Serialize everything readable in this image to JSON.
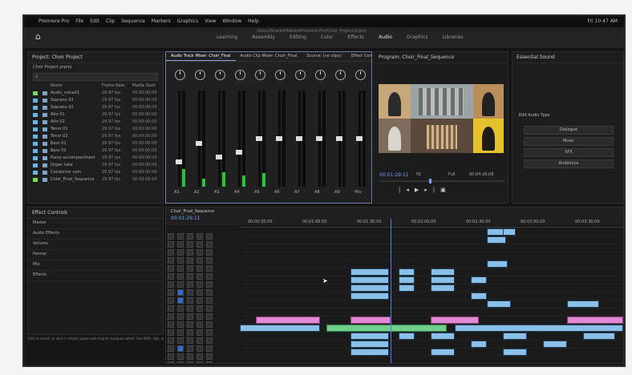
{
  "menubar": {
    "apple": "",
    "items": [
      "Premiere Pro",
      "File",
      "Edit",
      "Clip",
      "Sequence",
      "Markers",
      "Graphics",
      "View",
      "Window",
      "Help"
    ],
    "status": "Fri 10:47 AM"
  },
  "app": {
    "title": "/Users/Shared/Adobe/Premiere Pro/Choir_Project.prproj",
    "workspaces": [
      "Learning",
      "Assembly",
      "Editing",
      "Color",
      "Effects",
      "Audio",
      "Graphics",
      "Libraries"
    ],
    "active_workspace": "Audio"
  },
  "project_panel": {
    "title": "Project: Choir Project",
    "bin": "Choir Project.prproj",
    "search_placeholder": "",
    "columns": [
      "Name",
      "Frame Rate",
      "Media Start"
    ],
    "rows": [
      {
        "name": "Audio_voice01",
        "swatch": "#7ed957",
        "rate": "29.97 fps",
        "start": "00:00:00:00"
      },
      {
        "name": "Soprano 01",
        "swatch": "#67b7e3",
        "rate": "29.97 fps",
        "start": "00:00:00:00"
      },
      {
        "name": "Soprano 02",
        "swatch": "#67b7e3",
        "rate": "29.97 fps",
        "start": "00:00:00:00"
      },
      {
        "name": "Alto 01",
        "swatch": "#67b7e3",
        "rate": "29.97 fps",
        "start": "00:00:00:00"
      },
      {
        "name": "Alto 02",
        "swatch": "#67b7e3",
        "rate": "29.97 fps",
        "start": "00:00:00:00"
      },
      {
        "name": "Tenor 01",
        "swatch": "#67b7e3",
        "rate": "29.97 fps",
        "start": "00:00:00:00"
      },
      {
        "name": "Tenor 02",
        "swatch": "#67b7e3",
        "rate": "29.97 fps",
        "start": "00:00:00:00"
      },
      {
        "name": "Bass 01",
        "swatch": "#67b7e3",
        "rate": "29.97 fps",
        "start": "00:00:00:00"
      },
      {
        "name": "Bass 02",
        "swatch": "#67b7e3",
        "rate": "29.97 fps",
        "start": "00:00:00:00"
      },
      {
        "name": "Piano accompaniment",
        "swatch": "#67b7e3",
        "rate": "29.97 fps",
        "start": "00:00:00:00"
      },
      {
        "name": "Organ take",
        "swatch": "#67b7e3",
        "rate": "29.97 fps",
        "start": "00:00:00:00"
      },
      {
        "name": "Conductor cam",
        "swatch": "#67b7e3",
        "rate": "29.97 fps",
        "start": "00:00:00:00"
      },
      {
        "name": "Choir_Final_Sequence",
        "swatch": "#7ed957",
        "rate": "29.97 fps",
        "start": "00:00:00:00"
      }
    ]
  },
  "lower_left": {
    "title": "Effect Controls",
    "rows": [
      "Master",
      "Audio Effects",
      "Volume",
      "Panner",
      "Mix",
      "Effects"
    ]
  },
  "mixer": {
    "tabs": [
      "Audio Track Mixer: Choir_Final",
      "Audio Clip Mixer: Choir_Final",
      "Source: (no clips)",
      "Effect Controls"
    ],
    "active_tab": 0,
    "strips": [
      {
        "label": "A1",
        "level": 0.18,
        "fader": 0.25
      },
      {
        "label": "A2",
        "level": 0.08,
        "fader": 0.45
      },
      {
        "label": "A3",
        "level": 0.15,
        "fader": 0.3
      },
      {
        "label": "A4",
        "level": 0.12,
        "fader": 0.35
      },
      {
        "label": "A5",
        "level": 0.14,
        "fader": 0.5
      },
      {
        "label": "A6",
        "level": 0.0,
        "fader": 0.5
      },
      {
        "label": "A7",
        "level": 0.0,
        "fader": 0.5
      },
      {
        "label": "A8",
        "level": 0.0,
        "fader": 0.5
      },
      {
        "label": "A9",
        "level": 0.0,
        "fader": 0.5
      },
      {
        "label": "Mix",
        "level": 0.0,
        "fader": 0.5
      }
    ]
  },
  "program": {
    "title": "Program: Choir_Final_Sequence",
    "timecode": "00:01:29:11",
    "fit": "Fit",
    "quality": "Full",
    "duration": "00:04:26:08"
  },
  "right_panel": {
    "title": "Essential Sound",
    "buttons": [
      "Dialogue",
      "Music",
      "SFX",
      "Ambience"
    ],
    "sub_title": "Edit Audio Type"
  },
  "timeline": {
    "tab": "Choir_Final_Sequence",
    "timecode": "00:01:29:11",
    "ruler": [
      "00:00:30:00",
      "00:01:00:00",
      "00:01:30:00",
      "00:02:00:00",
      "00:02:30:00",
      "00:03:00:00",
      "00:03:30:00"
    ]
  },
  "status_bar": "Click to select, or click in empty space and drag to marquee select. Use Shift, Opt, and Cmd for other options."
}
